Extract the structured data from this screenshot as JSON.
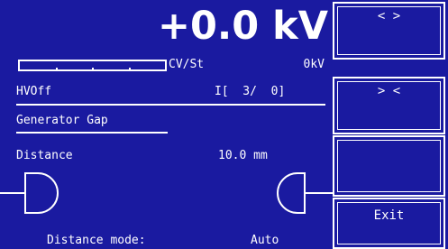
{
  "readout": {
    "voltage": "+0.0 kV",
    "meter_label": "CV/St",
    "meter_value": "0kV"
  },
  "status": {
    "hv_state": "HVOff",
    "indicator": "I[  3/  0]"
  },
  "section": {
    "title": "Generator Gap",
    "distance_label": "Distance",
    "distance_value": "10.0 mm",
    "mode_label": "Distance mode:",
    "mode_value": "Auto"
  },
  "buttons": {
    "widen": "< >",
    "narrow": "> <",
    "blank": "",
    "exit": "Exit"
  },
  "icons": {
    "left": "electrode-left-icon",
    "right": "electrode-right-icon"
  },
  "colors": {
    "background": "#1a1aa0",
    "foreground": "#ffffff"
  }
}
